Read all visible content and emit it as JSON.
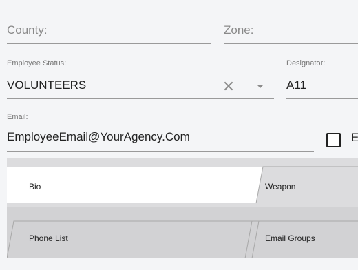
{
  "form": {
    "county": {
      "placeholder": "County:"
    },
    "zone": {
      "placeholder": "Zone:"
    },
    "employee_status": {
      "label": "Employee Status:",
      "value": "VOLUNTEERS"
    },
    "designator": {
      "label": "Designator:",
      "value": "A11"
    },
    "email": {
      "label": "Email:",
      "value": "EmployeeEmail@YourAgency.Com"
    },
    "checkbox": {
      "label": "E",
      "checked": false
    }
  },
  "tabs": [
    {
      "label": "Bio",
      "active": true
    },
    {
      "label": "Weapon",
      "active": false
    },
    {
      "label": "Phone List",
      "active": false
    },
    {
      "label": "Email Groups",
      "active": false
    }
  ],
  "icons": {
    "clear": "close-icon",
    "dropdown": "chevron-down-icon",
    "checkbox": "checkbox-icon"
  }
}
